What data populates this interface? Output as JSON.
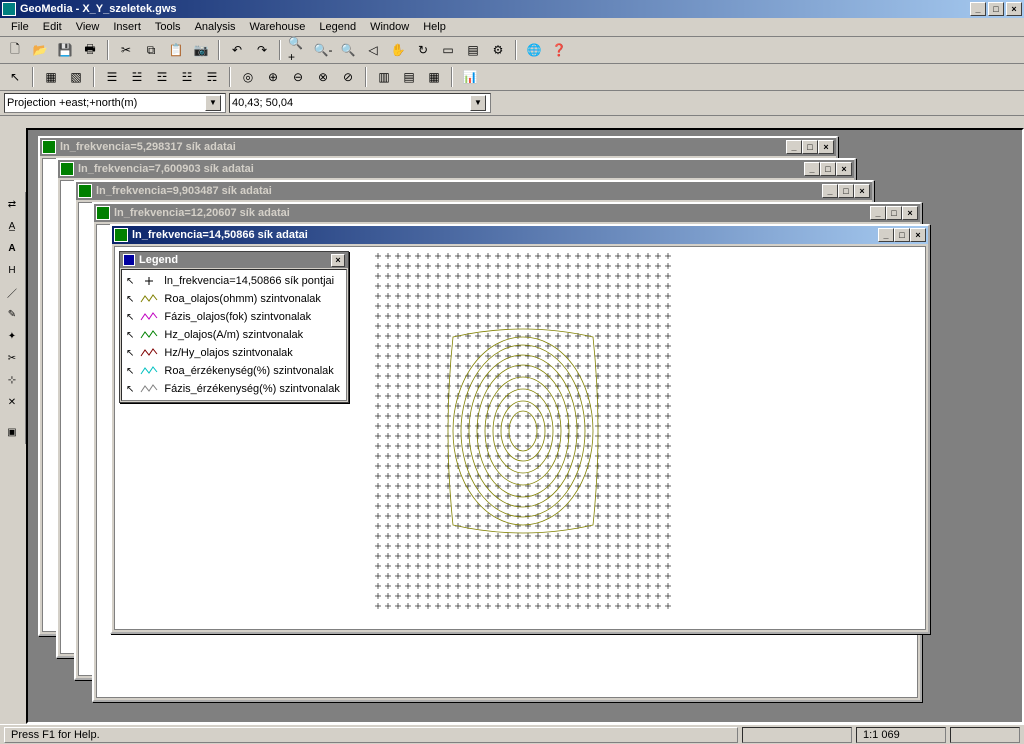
{
  "app": {
    "title": "GeoMedia - X_Y_szeletek.gws"
  },
  "menu": {
    "items": [
      "File",
      "Edit",
      "View",
      "Insert",
      "Tools",
      "Analysis",
      "Warehouse",
      "Legend",
      "Window",
      "Help"
    ]
  },
  "toolbar3": {
    "projection": "Projection +east;+north(m)",
    "coords": "40,43; 50,04"
  },
  "windows": [
    {
      "title": "ln_frekvencia=5,298317 sík adatai"
    },
    {
      "title": "ln_frekvencia=7,600903 sík adatai"
    },
    {
      "title": "ln_frekvencia=9,903487 sík adatai"
    },
    {
      "title": "ln_frekvencia=12,20607 sík adatai"
    },
    {
      "title": "ln_frekvencia=14,50866 sík adatai"
    }
  ],
  "legend": {
    "title": "Legend",
    "items": [
      {
        "symbol": "cross",
        "label": "ln_frekvencia=14,50866 sík pontjai"
      },
      {
        "symbol": "line",
        "color": "#808000",
        "label": "Roa_olajos(ohmm) szintvonalak"
      },
      {
        "symbol": "line",
        "color": "#c000c0",
        "label": "Fázis_olajos(fok) szintvonalak"
      },
      {
        "symbol": "line",
        "color": "#008000",
        "label": "Hz_olajos(A/m) szintvonalak"
      },
      {
        "symbol": "line",
        "color": "#800000",
        "label": "Hz/Hy_olajos szintvonalak"
      },
      {
        "symbol": "line",
        "color": "#00c0c0",
        "label": "Roa_érzékenység(%) szintvonalak"
      },
      {
        "symbol": "line",
        "color": "#808080",
        "label": "Fázis_érzékenység(%) szintvonalak"
      }
    ]
  },
  "status": {
    "hint": "Press F1 for Help.",
    "scale": "1:1 069"
  },
  "chart_data": {
    "type": "contour",
    "description": "Contour map on regular grid",
    "grid": {
      "nx": 30,
      "ny": 36,
      "x_range": [
        0,
        100
      ],
      "y_range": [
        0,
        100
      ]
    },
    "center": {
      "x": 50,
      "y": 50
    },
    "levels_approx": [
      10,
      20,
      30,
      40,
      50,
      60,
      70,
      80,
      90
    ],
    "main_series_color": "#808000"
  }
}
